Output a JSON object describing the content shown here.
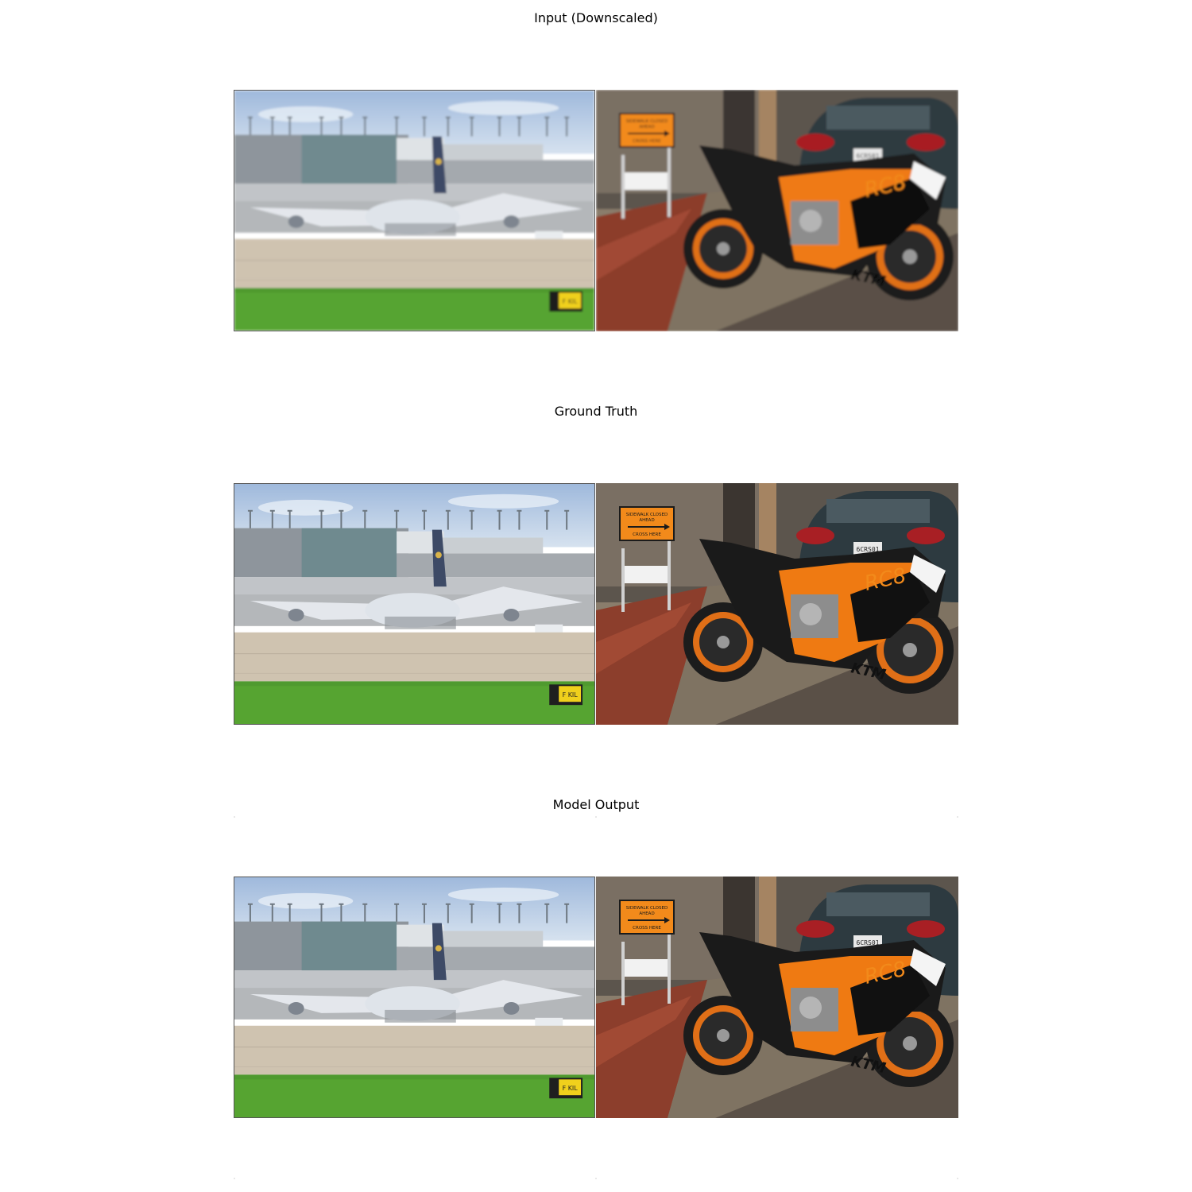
{
  "panels": [
    {
      "title": "Input (Downscaled)",
      "variant": "blurred"
    },
    {
      "title": "Ground Truth",
      "variant": "sharp"
    },
    {
      "title": "Model Output",
      "variant": "sharp"
    }
  ],
  "images": {
    "left": {
      "subject": "airplane-on-tarmac-photo",
      "sign_text": "F KIL"
    },
    "right": {
      "subject": "orange-sport-motorcycle-photo",
      "street_sign": [
        "SIDEWALK CLOSED",
        "AHEAD",
        "CROSS HERE"
      ],
      "bike_text": [
        "RC8",
        "KTM"
      ],
      "plate_text": "6CRS01"
    }
  }
}
